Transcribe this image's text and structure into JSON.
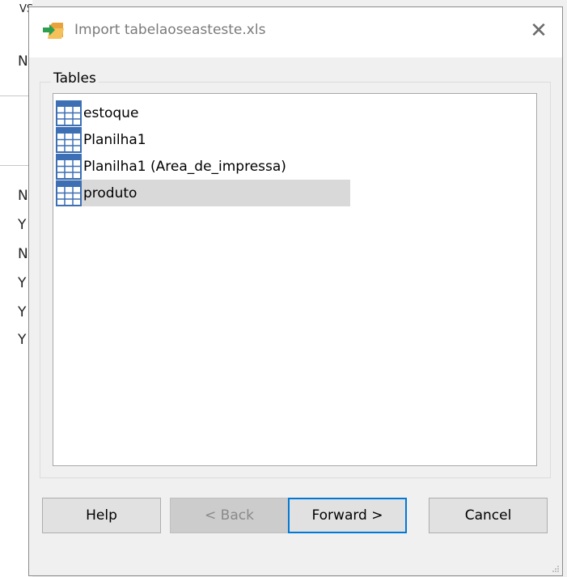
{
  "background": {
    "peek_letters": [
      "VS",
      "N",
      "N",
      "Y",
      "N",
      "Y",
      "Y",
      "Y"
    ]
  },
  "dialog": {
    "title": "Import tabelaoseasteste.xls",
    "title_icon": "import-arrow-folder-icon",
    "close_glyph": "✕"
  },
  "tables_group": {
    "label": "Tables",
    "items": [
      {
        "label": "estoque",
        "selected": false
      },
      {
        "label": "Planilha1",
        "selected": false
      },
      {
        "label": "Planilha1 (Area_de_impressa)",
        "selected": false
      },
      {
        "label": "produto",
        "selected": true
      }
    ]
  },
  "buttons": {
    "help": "Help",
    "back": "< Back",
    "forward": "Forward >",
    "cancel": "Cancel"
  },
  "colors": {
    "accent": "#0078d7",
    "selection": "#d9d9d9",
    "table_icon_header": "#3c6fb4"
  }
}
